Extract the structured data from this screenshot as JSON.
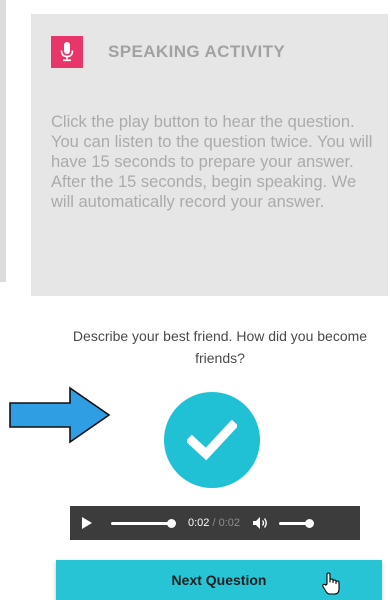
{
  "instructions": {
    "title": "SPEAKING ACTIVITY",
    "icon": "microphone-icon",
    "accent_color": "#e8356a",
    "body": "Click the play button to hear the question. You can listen to the question twice. You will have 15 seconds to prepare your answer. After the 15 seconds, begin speaking. We will automatically record your answer."
  },
  "question": {
    "text": "Describe your best friend. How did you become friends?"
  },
  "indicator": {
    "icon": "right-arrow-icon",
    "color": "#2f9ee3"
  },
  "status": {
    "icon": "checkmark-icon",
    "color": "#20c1d4"
  },
  "audio": {
    "current_time": "0:02",
    "separator": "/",
    "total_time": "0:02",
    "progress": 1.0,
    "volume": 1.0
  },
  "next_button": {
    "label": "Next Question",
    "color": "#27c4d6"
  }
}
